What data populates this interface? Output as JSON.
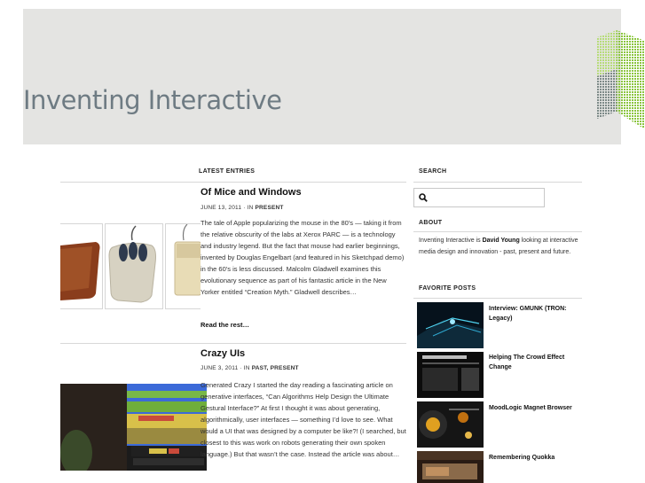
{
  "site": {
    "title": "Inventing Interactive"
  },
  "main": {
    "section_label": "LATEST ENTRIES",
    "posts": [
      {
        "title": "Of Mice and Windows",
        "date": "JUNE 13, 2011",
        "sep": " · IN ",
        "category": "PRESENT",
        "excerpt": "The tale of Apple popularizing the mouse in the 80’s — taking it from the relative obscurity of the labs at Xerox PARC — is a technology and industry legend. But the fact that mouse had earlier beginnings, invented by Douglas Engelbart (and featured in his Sketchpad demo) in the 60’s is less discussed. Malcolm Gladwell examines this evolutionary sequence as part of his fantastic article in the New Yorker entitled “Creation Myth.” Gladwell describes…",
        "read_more": "Read the rest…"
      },
      {
        "title": "Crazy UIs",
        "date": "JUNE 3, 2011",
        "sep": " · IN ",
        "category": "PAST, PRESENT",
        "excerpt": "Generated Crazy I started the day reading a fascinating article on generative interfaces, “Can Algorithms Help Design the Ultimate Gestural Interface?” At first I thought it was about generating, algorithmically, user interfaces — something I’d love to see. What would a UI that was designed by a computer be like?! (I searched, but closest to this was work on robots generating their own spoken language.) But that wasn’t the case. Instead the article was about…"
      }
    ]
  },
  "sidebar": {
    "search": {
      "label": "SEARCH",
      "placeholder": "",
      "icon": "search-icon"
    },
    "about": {
      "label": "ABOUT",
      "text_before": "Inventing Interactive is ",
      "author": "David Young",
      "text_after": " looking at interactive media design and innovation - past, present and future."
    },
    "favorites": {
      "label": "FAVORITE POSTS",
      "items": [
        {
          "title": "Interview: GMUNK (TRON: Legacy)"
        },
        {
          "title": "Helping The Crowd Effect Change"
        },
        {
          "title": "MoodLogic Magnet Browser"
        },
        {
          "title": "Remembering Quokka"
        }
      ]
    }
  },
  "colors": {
    "banner": "#e4e4e2",
    "title": "#6e7b83",
    "logo_green": "#8bc53f"
  }
}
